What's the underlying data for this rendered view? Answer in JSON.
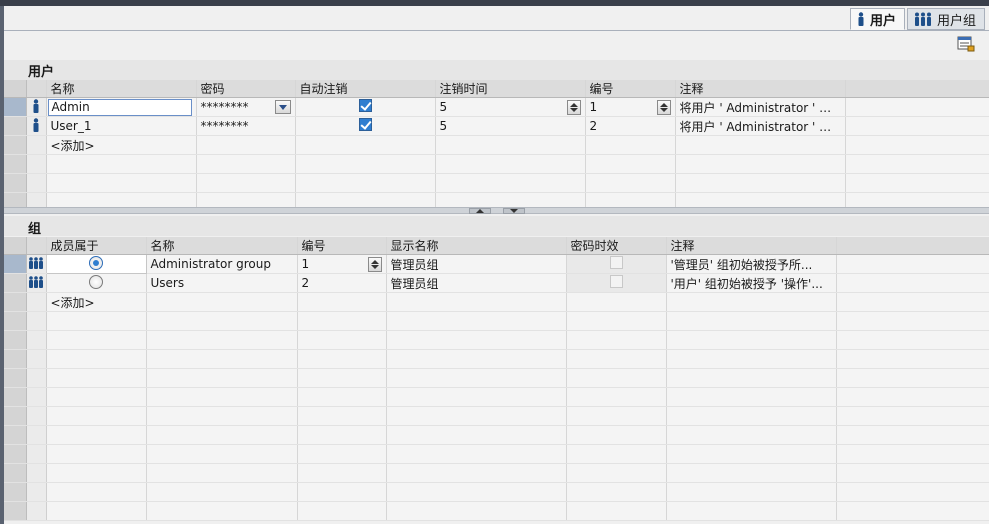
{
  "tabs": [
    {
      "label": "用户",
      "icon": "user-icon",
      "active": true
    },
    {
      "label": "用户组",
      "icon": "user-group-icon",
      "active": false
    }
  ],
  "users": {
    "title": "用户",
    "columns": [
      "名称",
      "密码",
      "自动注销",
      "注销时间",
      "编号",
      "注释"
    ],
    "rows": [
      {
        "name": "Admin",
        "password": "********",
        "auto_logoff": true,
        "logoff_time": "5",
        "number": "1",
        "comment": "将用户 ' Administrator ' 分..."
      },
      {
        "name": "User_1",
        "password": "********",
        "auto_logoff": true,
        "logoff_time": "5",
        "number": "2",
        "comment": "将用户 ' Administrator ' 分..."
      }
    ],
    "add_label": "<添加>"
  },
  "groups": {
    "title": "组",
    "columns": [
      "成员属于",
      "名称",
      "编号",
      "显示名称",
      "密码时效",
      "注释"
    ],
    "rows": [
      {
        "member_of": true,
        "name": "Administrator group",
        "number": "1",
        "display_name": "管理员组",
        "password_aging": false,
        "comment": "'管理员' 组初始被授予所..."
      },
      {
        "member_of": false,
        "name": "Users",
        "number": "2",
        "display_name": "管理员组",
        "password_aging": false,
        "comment": "'用户' 组初始被授予 '操作'..."
      }
    ],
    "add_label": "<添加>"
  },
  "colors": {
    "accent": "#2f7ed0",
    "header_bg": "#dcdcdc",
    "panel_bg": "#f0f0f0"
  }
}
